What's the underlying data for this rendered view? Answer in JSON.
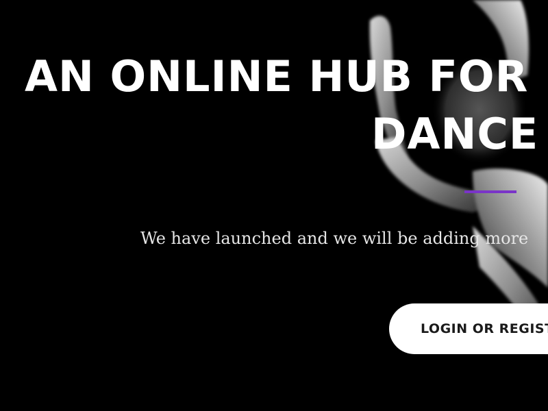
{
  "hero": {
    "headline_line1": "AN ONLINE HUB FOR",
    "headline_line2": "DANCE",
    "tagline": "We have launched and we will be adding more",
    "cta_label": "LOGIN OR REGISTER"
  },
  "colors": {
    "background": "#000000",
    "accent": "#7a34c8",
    "button_bg": "#ffffff",
    "text": "#ffffff"
  }
}
